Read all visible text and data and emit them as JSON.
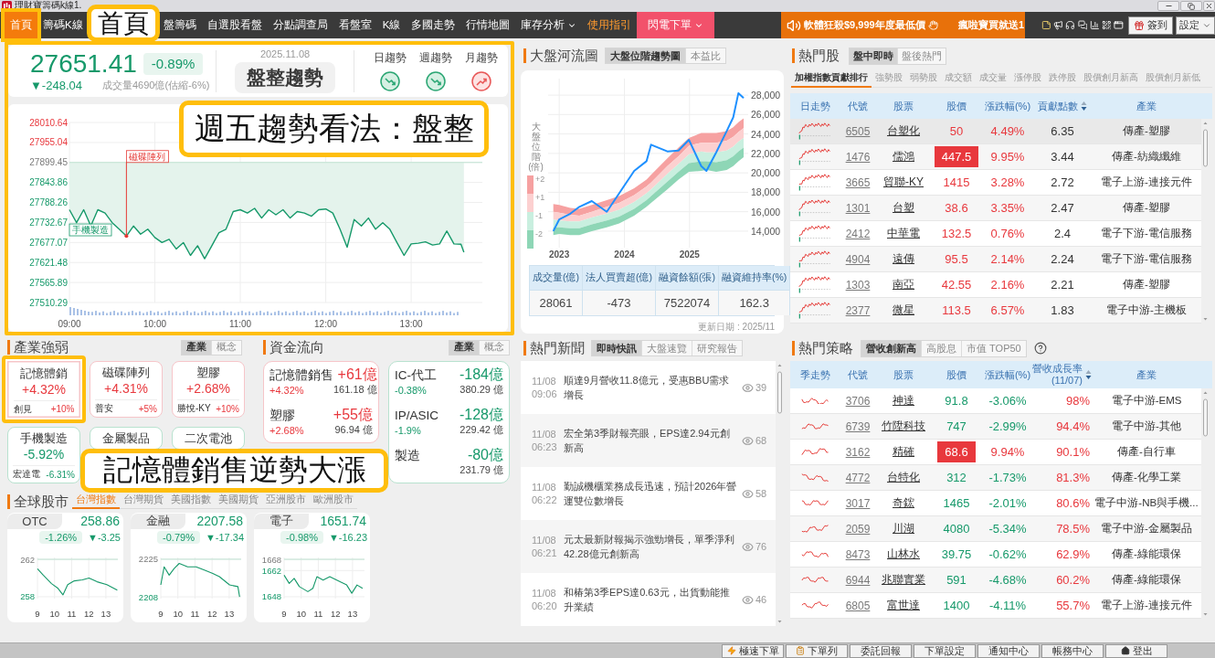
{
  "window": {
    "title": "理財寶籌碼k線1."
  },
  "nav": {
    "callout": "首頁",
    "items": [
      {
        "label": "首頁",
        "kind": "page",
        "selected": true,
        "highlighted": true,
        "dropdown": false
      },
      {
        "label": "籌碼K線",
        "kind": "page",
        "selected": false,
        "highlighted": false,
        "dropdown": false
      },
      {
        "label": "盤籌碼",
        "kind": "page",
        "selected": false,
        "highlighted": false,
        "dropdown": false
      },
      {
        "label": "自選股看盤",
        "kind": "page",
        "selected": false,
        "highlighted": false,
        "dropdown": false
      },
      {
        "label": "分點調查局",
        "kind": "page",
        "selected": false,
        "highlighted": false,
        "dropdown": false
      },
      {
        "label": "看盤室",
        "kind": "page",
        "selected": false,
        "highlighted": false,
        "dropdown": false
      },
      {
        "label": "K線",
        "kind": "page",
        "selected": false,
        "highlighted": false,
        "dropdown": false
      },
      {
        "label": "多國走勢",
        "kind": "page",
        "selected": false,
        "highlighted": false,
        "dropdown": false
      },
      {
        "label": "行情地圖",
        "kind": "page",
        "selected": false,
        "highlighted": false,
        "dropdown": false
      },
      {
        "label": "庫存分析",
        "kind": "page",
        "selected": false,
        "highlighted": false,
        "dropdown": true
      },
      {
        "label": "使用指引",
        "kind": "guide",
        "selected": false,
        "highlighted": false,
        "dropdown": false
      },
      {
        "label": "閃電下單",
        "kind": "flash",
        "selected": false,
        "highlighted": false,
        "dropdown": true
      }
    ]
  },
  "promo": {
    "headline": "軟體狂殺$9,999年度最低價",
    "ticker": "瘋啦寶買就送1"
  },
  "toolbar": {
    "buttons": [
      {
        "label": "簽到",
        "kind": "checkin"
      },
      {
        "label": "設定",
        "kind": "settings"
      }
    ]
  },
  "market_overview": {
    "highlighted": true,
    "index": "27651.41",
    "change_pct": "-0.89%",
    "change": "▼-248.04",
    "rising": false,
    "volume": "成交量4690億(估縮-6%)",
    "date": "2025.11.08",
    "trend_label": "盤整趨勢",
    "trends": [
      {
        "label": "日趨勢",
        "rising": false
      },
      {
        "label": "週趨勢",
        "rising": false
      },
      {
        "label": "月趨勢",
        "rising": true
      }
    ],
    "callout": "週五趨勢看法：盤整",
    "event_markers": [
      {
        "rising": false
      },
      {
        "rising": true
      }
    ],
    "chart_data": {
      "type": "line",
      "x": [
        9,
        9.083,
        9.167,
        9.25,
        9.333,
        9.417,
        9.5,
        9.583,
        9.667,
        9.75,
        9.833,
        9.917,
        10,
        10.083,
        10.167,
        10.25,
        10.333,
        10.417,
        10.5,
        10.583,
        10.667,
        10.75,
        10.833,
        10.917,
        11,
        11.083,
        11.167,
        11.25,
        11.333,
        11.417,
        11.5,
        11.583,
        11.667,
        11.75,
        11.833,
        11.917,
        12,
        12.083,
        12.167,
        12.25,
        12.333,
        12.417,
        12.5,
        12.583,
        12.667,
        12.75,
        12.833,
        12.917,
        13,
        13.083,
        13.167,
        13.25,
        13.333,
        13.417,
        13.5,
        13.583,
        13.617
      ],
      "values": [
        27768,
        27732,
        27768,
        27723,
        27768,
        27759,
        27732,
        27714,
        27695,
        27723,
        27700,
        27714,
        27691,
        27677,
        27686,
        27659,
        27677,
        27641,
        27668,
        27632,
        27668,
        27704,
        27714,
        27763,
        27768,
        27759,
        27772,
        27745,
        27768,
        27754,
        27768,
        27745,
        27763,
        27759,
        27750,
        27768,
        27770,
        27759,
        27714,
        27664,
        27741,
        27723,
        27745,
        27714,
        27732,
        27714,
        27677,
        27641,
        27673,
        27675,
        27679,
        27670,
        27673,
        27709,
        27673,
        27672,
        27650
      ],
      "xlim": [
        9,
        13.833
      ],
      "ylim": [
        27510.29,
        28010.64
      ],
      "xticks": [
        {
          "value": 9,
          "label": "09:00"
        },
        {
          "value": 10,
          "label": "10:00"
        },
        {
          "value": 11,
          "label": "11:00"
        },
        {
          "value": 12,
          "label": "12:00"
        },
        {
          "value": 13,
          "label": "13:00"
        }
      ],
      "yticks": [
        28010.64,
        27955.04,
        27899.45,
        27843.86,
        27788.26,
        27732.67,
        27677.07,
        27621.48,
        27565.89,
        27510.29
      ],
      "grid": true,
      "ref_lines": [
        {
          "axis": "y",
          "value": 27899.45
        }
      ],
      "annotations": [
        {
          "text": "手機製造",
          "x": 9,
          "y": 27768
        },
        {
          "text": "磁碟陣列",
          "x": 9.667,
          "y": 27695
        }
      ]
    }
  },
  "river": {
    "title": "大盤河流圖",
    "tabs": [
      {
        "label": "大盤位階趨勢圖",
        "selected": true
      },
      {
        "label": "本益比",
        "selected": false
      }
    ],
    "legend_title": "大盤位階(倍)",
    "chart_data": {
      "type": "area",
      "x": [
        2022.91,
        2023.0,
        2023.17,
        2023.31,
        2023.5,
        2023.73,
        2023.92,
        2024.15,
        2024.34,
        2024.41,
        2024.66,
        2024.83,
        2024.99,
        2025.18,
        2025.26,
        2025.41,
        2025.57,
        2025.67,
        2025.75,
        2025.83
      ],
      "series": [
        {
          "name": "+2",
          "color": "#f6a1a1",
          "values": [
            16800,
            16700,
            16400,
            16300,
            16700,
            17200,
            17600,
            18400,
            19300,
            19800,
            21500,
            22600,
            23600,
            24100,
            24100,
            24100,
            24300,
            24700,
            25200,
            25600
          ]
        },
        {
          "name": "+1",
          "color": "#fcd0d0",
          "values": [
            16000,
            15900,
            15700,
            15600,
            16000,
            16500,
            16900,
            17700,
            18600,
            19000,
            20700,
            21700,
            22800,
            23100,
            23100,
            23100,
            23300,
            23700,
            24200,
            24600
          ]
        },
        {
          "name": "-1",
          "color": "#c9efdf",
          "values": [
            15200,
            15100,
            15000,
            15000,
            15400,
            15800,
            16200,
            17000,
            17900,
            18300,
            19900,
            20900,
            21900,
            22200,
            22100,
            22100,
            22300,
            22700,
            23200,
            23600
          ]
        },
        {
          "name": "-2",
          "color": "#8ed6b6",
          "values": [
            14400,
            14400,
            14300,
            14300,
            14700,
            15100,
            15500,
            16300,
            17200,
            17600,
            19100,
            20100,
            21000,
            21200,
            21200,
            21100,
            21300,
            21700,
            22200,
            22600
          ]
        },
        {
          "type": "line",
          "color": "#1e90ff",
          "values": [
            14000,
            15200,
            15800,
            16500,
            17100,
            16000,
            17900,
            20200,
            21200,
            22900,
            22200,
            22300,
            23400,
            20700,
            20200,
            22100,
            24300,
            25700,
            28200,
            27700
          ]
        }
      ],
      "xlim": [
        2022.83,
        2025.9
      ],
      "ylim": [
        12300,
        29700
      ],
      "grid": true,
      "xticks": [
        2023,
        2024,
        2025
      ],
      "yticks": [
        {
          "value": 14000,
          "label": "14,000"
        },
        {
          "value": 16000,
          "label": "16,000"
        },
        {
          "value": 18000,
          "label": "18,000"
        },
        {
          "value": 20000,
          "label": "20,000"
        },
        {
          "value": 22000,
          "label": "22,000"
        },
        {
          "value": 24000,
          "label": "24,000"
        },
        {
          "value": 26000,
          "label": "26,000"
        },
        {
          "value": 28000,
          "label": "28,000"
        }
      ]
    },
    "stats": [
      {
        "label": "成交量(億)",
        "value": "28061"
      },
      {
        "label": "法人買賣超(億)",
        "value": "-473"
      },
      {
        "label": "融資餘額(張)",
        "value": "7522074"
      },
      {
        "label": "融資維持率(%)",
        "value": "162.3"
      }
    ],
    "updated": "更新日期 : 2025/11"
  },
  "hot_stocks": {
    "title": "熱門股",
    "tabs": [
      {
        "label": "盤中即時",
        "selected": true
      },
      {
        "label": "盤後熱門",
        "selected": false
      }
    ],
    "subtabs": [
      {
        "label": "加權指數貢獻排行",
        "selected": true
      },
      {
        "label": "強勢股",
        "selected": false
      },
      {
        "label": "弱勢股",
        "selected": false
      },
      {
        "label": "成交額",
        "selected": false
      },
      {
        "label": "成交量",
        "selected": false
      },
      {
        "label": "漲停股",
        "selected": false
      },
      {
        "label": "跌停股",
        "selected": false
      },
      {
        "label": "股價創月新高",
        "selected": false
      },
      {
        "label": "股價創月新低",
        "selected": false
      }
    ],
    "columns": [
      {
        "label": "日走勢",
        "sortable": false
      },
      {
        "label": "代號",
        "sortable": false
      },
      {
        "label": "股票",
        "sortable": false
      },
      {
        "label": "股價",
        "sortable": false
      },
      {
        "label": "漲跌幅(%)",
        "sortable": false
      },
      {
        "label": "貢獻點數",
        "sortable": true
      },
      {
        "label": "產業",
        "sortable": false
      }
    ],
    "rows": [
      {
        "selected": true,
        "code": "6505",
        "name": "台塑化",
        "price": "50",
        "change": "4.49%",
        "points": "6.35",
        "industry": "傳產-塑膠",
        "rising": true,
        "limit": false
      },
      {
        "selected": false,
        "code": "1476",
        "name": "儒鴻",
        "price": "447.5",
        "change": "9.95%",
        "points": "3.44",
        "industry": "傳產-紡織纖維",
        "rising": true,
        "limit": true
      },
      {
        "selected": false,
        "code": "3665",
        "name": "貿聯-KY",
        "price": "1415",
        "change": "3.28%",
        "points": "2.72",
        "industry": "電子上游-連接元件",
        "rising": true,
        "limit": false
      },
      {
        "selected": false,
        "code": "1301",
        "name": "台塑",
        "price": "38.6",
        "change": "3.35%",
        "points": "2.47",
        "industry": "傳產-塑膠",
        "rising": true,
        "limit": false
      },
      {
        "selected": false,
        "code": "2412",
        "name": "中華電",
        "price": "132.5",
        "change": "0.76%",
        "points": "2.4",
        "industry": "電子下游-電信服務",
        "rising": true,
        "limit": false
      },
      {
        "selected": false,
        "code": "4904",
        "name": "遠傳",
        "price": "95.5",
        "change": "2.14%",
        "points": "2.24",
        "industry": "電子下游-電信服務",
        "rising": true,
        "limit": false
      },
      {
        "selected": false,
        "code": "1303",
        "name": "南亞",
        "price": "42.55",
        "change": "2.16%",
        "points": "2.21",
        "industry": "傳產-塑膠",
        "rising": true,
        "limit": false
      },
      {
        "selected": false,
        "code": "2377",
        "name": "微星",
        "price": "113.5",
        "change": "6.57%",
        "points": "1.83",
        "industry": "電子中游-主機板",
        "rising": true,
        "limit": false
      }
    ]
  },
  "industry": {
    "title": "產業強弱",
    "tabs": [
      {
        "label": "產業",
        "selected": true
      },
      {
        "label": "概念",
        "selected": false
      }
    ],
    "callout": "記憶體銷售逆勢大漲",
    "cards": [
      {
        "name": "記憶體銷",
        "change": "+4.32%",
        "leader": "創見",
        "leader_change": "+10%",
        "rising": true,
        "highlighted": true
      },
      {
        "name": "磁碟陣列",
        "change": "+4.31%",
        "leader": "普安",
        "leader_change": "+5%",
        "rising": true,
        "highlighted": false
      },
      {
        "name": "塑膠",
        "change": "+2.68%",
        "leader": "勝悅-KY",
        "leader_change": "+10%",
        "rising": true,
        "highlighted": false
      },
      {
        "name": "手機製造",
        "change": "-5.92%",
        "leader": "宏達電",
        "leader_change": "-6.31%",
        "rising": false,
        "highlighted": false
      },
      {
        "name": "金屬製品",
        "rising": false,
        "highlighted": false
      },
      {
        "name": "二次電池",
        "rising": false,
        "highlighted": false
      }
    ]
  },
  "fund_flow": {
    "title": "資金流向",
    "tabs": [
      {
        "label": "產業",
        "selected": true
      },
      {
        "label": "概念",
        "selected": false
      }
    ],
    "groups": [
      {
        "rising": true,
        "items": [
          {
            "name": "記憶體銷售",
            "amount": "+61億",
            "change": "+4.32%",
            "total": "161.18 億"
          },
          {
            "name": "塑膠",
            "amount": "+55億",
            "change": "+2.68%",
            "total": "96.94 億"
          }
        ]
      },
      {
        "rising": false,
        "items": [
          {
            "name": "IC-代工",
            "amount": "-184億",
            "change": "-0.38%",
            "total": "380.29 億"
          },
          {
            "name": "IP/ASIC",
            "amount": "-128億",
            "change": "-1.9%",
            "total": "229.42 億"
          },
          {
            "name": "製造",
            "amount": "-80億",
            "total": "231.79 億"
          }
        ]
      }
    ]
  },
  "news": {
    "title": "熱門新聞",
    "tabs": [
      {
        "label": "即時快訊",
        "selected": true
      },
      {
        "label": "大盤速覽",
        "selected": false
      },
      {
        "label": "研究報告",
        "selected": false
      }
    ],
    "items": [
      {
        "date": "11/08",
        "time": "09:06",
        "headline": "順達9月營收11.8億元，受惠BBU需求增長",
        "views": "39"
      },
      {
        "date": "11/08",
        "time": "06:23",
        "headline": "宏全第3季財報亮眼，EPS達2.94元創新高",
        "views": "68"
      },
      {
        "date": "11/08",
        "time": "06:22",
        "headline": "勤誠機櫃業務成長迅速，預計2026年營運雙位數增長",
        "views": "58"
      },
      {
        "date": "11/08",
        "time": "06:21",
        "headline": "元太最新財報揭示強勁增長，單季淨利42.28億元創新高",
        "views": "76"
      },
      {
        "date": "11/08",
        "time": "06:20",
        "headline": "和椿第3季EPS達0.63元，出貨動能推升業績",
        "views": "46"
      }
    ]
  },
  "global_markets": {
    "title": "全球股市",
    "tabs": [
      {
        "label": "台灣指數",
        "selected": true
      },
      {
        "label": "台灣期貨",
        "selected": false
      },
      {
        "label": "美國指數",
        "selected": false
      },
      {
        "label": "美國期貨",
        "selected": false
      },
      {
        "label": "亞洲股市",
        "selected": false
      },
      {
        "label": "歐洲股市",
        "selected": false
      }
    ],
    "cards": [
      {
        "name": "OTC",
        "value": "258.86",
        "change_pct": "-1.26%",
        "change": "▼-3.25",
        "rising": false,
        "chart_data": {
          "type": "line",
          "x": [
            9.0,
            9.34,
            9.82,
            10.2,
            10.49,
            10.77,
            11.15,
            11.63,
            12.01,
            12.49,
            13.06,
            13.67
          ],
          "values": [
            261.0,
            260.3,
            259.4,
            258.9,
            258.2,
            259.3,
            259.7,
            259.8,
            260.0,
            259.6,
            259.3,
            258.7
          ],
          "xlim": [
            9,
            13.7
          ],
          "ylim": [
            257.8,
            262.2
          ],
          "grid": true,
          "xticks": [
            9,
            10,
            11,
            12,
            13
          ],
          "yticks": [
            262,
            258
          ],
          "ref_lines": [
            {
              "axis": "y",
              "value": 262
            }
          ]
        }
      },
      {
        "name": "金融",
        "value": "2207.58",
        "change_pct": "-0.79%",
        "change": "▼-17.34",
        "rising": false,
        "chart_data": {
          "type": "line",
          "x": [
            9.0,
            9.2,
            9.49,
            9.78,
            10.08,
            10.57,
            11.06,
            11.55,
            12.04,
            12.43,
            13.02,
            13.51,
            13.61
          ],
          "values": [
            2213.4,
            2221.6,
            2217.8,
            2220.8,
            2223.1,
            2221.6,
            2221.6,
            2220.1,
            2218.6,
            2217.1,
            2213.4,
            2212.6,
            2208
          ],
          "xlim": [
            9,
            13.7
          ],
          "ylim": [
            2207.2,
            2225.8
          ],
          "grid": true,
          "xticks": [
            9,
            10,
            11,
            12,
            13
          ],
          "yticks": [
            2225,
            2208
          ],
          "ref_lines": [
            {
              "axis": "y",
              "value": 2225
            }
          ]
        }
      },
      {
        "name": "電子",
        "value": "1651.74",
        "change_pct": "-0.98%",
        "change": "▼-16.23",
        "rising": false,
        "chart_data": {
          "type": "line",
          "x": [
            9.0,
            9.3,
            9.59,
            9.89,
            10.39,
            10.68,
            10.92,
            11.28,
            11.67,
            12.27,
            12.66,
            12.96,
            13.26,
            13.59
          ],
          "values": [
            1659.5,
            1655.1,
            1657.8,
            1653.4,
            1650.7,
            1652.5,
            1658.7,
            1656.9,
            1658.7,
            1656.0,
            1654.3,
            1649.9,
            1654.3,
            1652.5
          ],
          "xlim": [
            9,
            13.7
          ],
          "ylim": [
            1647,
            1669
          ],
          "grid": true,
          "xticks": [
            9,
            10,
            11,
            12,
            13
          ],
          "yticks": [
            1668,
            1662,
            1648
          ],
          "ref_lines": [
            {
              "axis": "y",
              "value": 1668
            }
          ]
        }
      }
    ]
  },
  "strategies": {
    "title": "熱門策略",
    "tabs": [
      {
        "label": "營收創新高",
        "selected": true
      },
      {
        "label": "高股息",
        "selected": false
      },
      {
        "label": "市值 TOP50",
        "selected": false
      }
    ],
    "columns": [
      {
        "label": "季走勢",
        "sortable": false
      },
      {
        "label": "代號",
        "sortable": false
      },
      {
        "label": "股票",
        "sortable": false
      },
      {
        "label": "股價",
        "sortable": false
      },
      {
        "label": "漲跌幅(%)",
        "sortable": false
      },
      {
        "label": "營收成長率",
        "sub": "(11/07)",
        "sortable": true
      },
      {
        "label": "產業",
        "sortable": false
      }
    ],
    "rows": [
      {
        "code": "3706",
        "name": "神達",
        "price": "91.8",
        "change": "-3.06%",
        "growth": "98%",
        "industry": "電子中游-EMS",
        "rising": false,
        "limit": false
      },
      {
        "code": "6739",
        "name": "竹陞科技",
        "price": "747",
        "change": "-2.99%",
        "growth": "94.4%",
        "industry": "電子中游-其他",
        "rising": false,
        "limit": false
      },
      {
        "code": "3162",
        "name": "精確",
        "price": "68.6",
        "change": "9.94%",
        "growth": "90.1%",
        "industry": "傳產-自行車",
        "rising": true,
        "limit": true
      },
      {
        "code": "4772",
        "name": "台特化",
        "price": "312",
        "change": "-1.73%",
        "growth": "81.3%",
        "industry": "傳產-化學工業",
        "rising": false,
        "limit": false
      },
      {
        "code": "3017",
        "name": "奇鋐",
        "price": "1465",
        "change": "-2.01%",
        "growth": "80.6%",
        "industry": "電子中游-NB與手機...",
        "rising": false,
        "limit": false
      },
      {
        "code": "2059",
        "name": "川湖",
        "price": "4080",
        "change": "-5.34%",
        "growth": "78.5%",
        "industry": "電子中游-金屬製品",
        "rising": false,
        "limit": false
      },
      {
        "code": "8473",
        "name": "山林水",
        "price": "39.75",
        "change": "-0.62%",
        "growth": "62.9%",
        "industry": "傳產-綠能環保",
        "rising": false,
        "limit": false
      },
      {
        "code": "6944",
        "name": "兆聯實業",
        "price": "591",
        "change": "-4.68%",
        "growth": "60.2%",
        "industry": "傳產-綠能環保",
        "rising": false,
        "limit": false
      },
      {
        "code": "6805",
        "name": "富世達",
        "price": "1400",
        "change": "-4.11%",
        "growth": "55.7%",
        "industry": "電子上游-連接元件",
        "rising": false,
        "limit": false
      }
    ]
  },
  "status_bar": {
    "buttons": [
      {
        "label": "極速下單",
        "kind": "flash"
      },
      {
        "label": "下單列",
        "kind": "orders"
      },
      {
        "label": "委託回報",
        "kind": "plain"
      },
      {
        "label": "下單設定",
        "kind": "plain"
      },
      {
        "label": "通知中心",
        "kind": "plain"
      },
      {
        "label": "帳務中心",
        "kind": "plain"
      },
      {
        "label": "登出",
        "kind": "logout"
      }
    ]
  }
}
